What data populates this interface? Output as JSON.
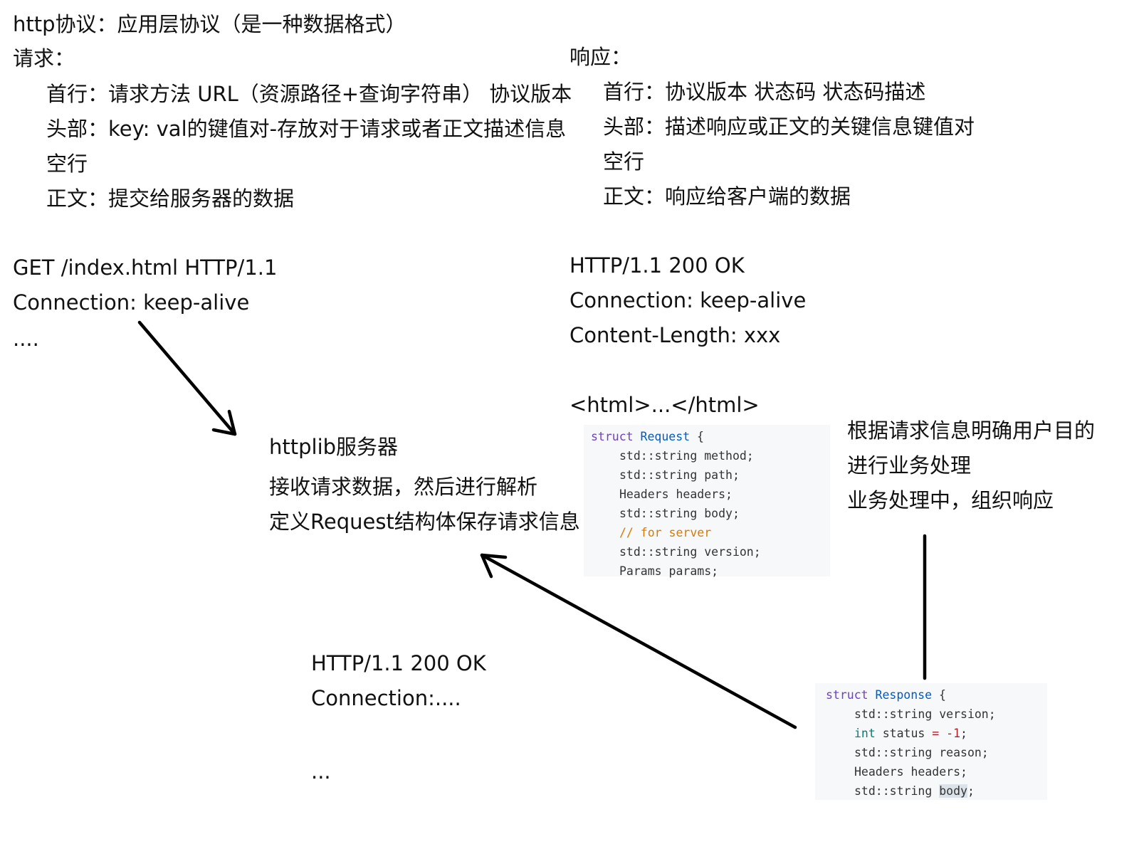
{
  "title": "http协议：应用层协议（是一种数据格式）",
  "request": {
    "heading": "请求：",
    "lines": [
      "首行：请求方法 URL（资源路径+查询字符串） 协议版本",
      "头部：key: val的键值对-存放对于请求或者正文描述信息",
      "空行",
      "正文：提交给服务器的数据"
    ],
    "example": [
      "GET /index.html HTTP/1.1",
      "Connection: keep-alive",
      "...."
    ]
  },
  "response": {
    "heading": "响应：",
    "lines": [
      "首行：协议版本 状态码 状态码描述",
      "头部：描述响应或正文的关键信息键值对",
      "空行",
      "正文：响应给客户端的数据"
    ],
    "example": [
      "HTTP/1.1 200 OK",
      "Connection: keep-alive",
      "Content-Length: xxx",
      "<html>...</html>"
    ]
  },
  "server": {
    "title": "httplib服务器",
    "lines": [
      "接收请求数据，然后进行解析",
      "定义Request结构体保存请求信息"
    ]
  },
  "business": {
    "lines": [
      "根据请求信息明确用户目的",
      "进行业务处理",
      "业务处理中，组织响应"
    ]
  },
  "response_output": [
    "HTTP/1.1 200 OK",
    "Connection:....",
    "..."
  ],
  "code_request": {
    "keyword": "struct",
    "name": "Request",
    "open": " {",
    "members": [
      "std::string method;",
      "std::string path;",
      "Headers headers;",
      "std::string body;",
      "// for server",
      "std::string version;",
      "Params params;"
    ]
  },
  "code_response": {
    "keyword": "struct",
    "name": "Response",
    "open": " {",
    "m1": "std::string version;",
    "m2_type": "int",
    "m2_name": " status ",
    "m2_op": "=",
    "m2_val": " -1",
    "m2_end": ";",
    "m3": "std::string reason;",
    "m4": "Headers headers;",
    "m5_a": "std::string ",
    "m5_b": "body",
    "m5_c": ";"
  }
}
